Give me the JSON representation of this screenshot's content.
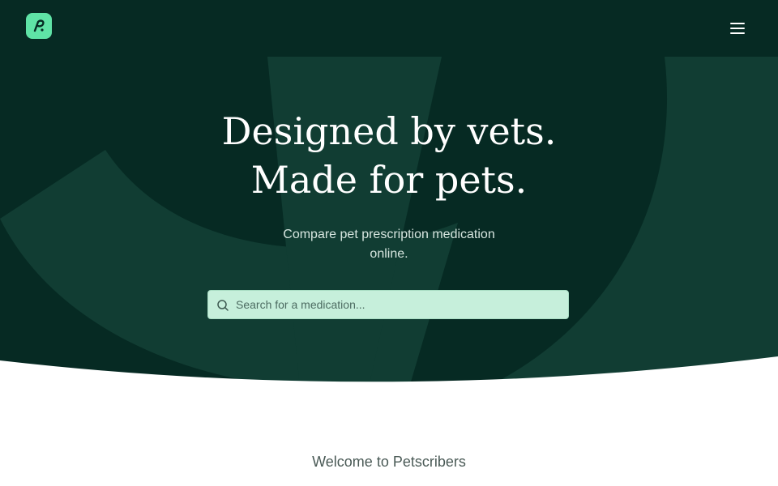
{
  "header": {
    "logo_icon": "petscribers-logo-icon",
    "menu_icon": "hamburger-menu-icon"
  },
  "hero": {
    "headline_line1": "Designed by vets.",
    "headline_line2": "Made for pets.",
    "subtitle": "Compare pet prescription medication online.",
    "background_color": "#062a23",
    "search": {
      "placeholder": "Search for a medication...",
      "value": "",
      "icon": "search-icon"
    }
  },
  "main": {
    "welcome": "Welcome to Petscribers"
  },
  "colors": {
    "brand_green": "#5fe3a6",
    "search_background": "#c6efdb"
  }
}
